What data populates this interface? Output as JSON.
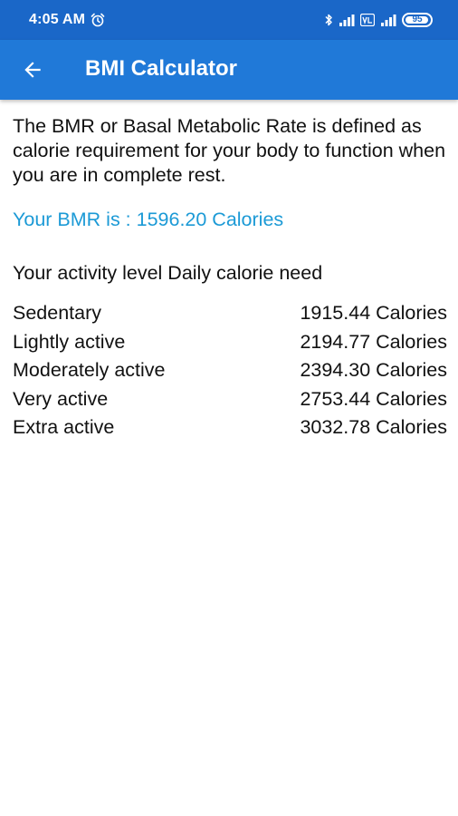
{
  "status_bar": {
    "time": "4:05 AM",
    "battery": "95",
    "battery_level_fraction": 0.95,
    "icons": [
      "alarm-icon",
      "bluetooth-icon",
      "signal-icon",
      "volte-icon",
      "wifi-signal-icon",
      "battery-icon"
    ]
  },
  "toolbar": {
    "title": "BMI Calculator",
    "back_icon": "arrow-left-icon",
    "color": "#2079d8"
  },
  "content": {
    "description": "The BMR or Basal Metabolic Rate is defined as calorie requirement for your body to function when you are in complete rest.",
    "bmr_result": "Your BMR is : 1596.20 Calories",
    "bmr_color": "#1c9ad6",
    "activity_header": "Your activity level Daily calorie need",
    "activities": [
      {
        "label": "Sedentary",
        "value": "1915.44 Calories"
      },
      {
        "label": "Lightly active",
        "value": "2194.77 Calories"
      },
      {
        "label": "Moderately active",
        "value": "2394.30 Calories"
      },
      {
        "label": "Very active",
        "value": "2753.44 Calories"
      },
      {
        "label": "Extra active",
        "value": "3032.78 Calories"
      }
    ]
  }
}
